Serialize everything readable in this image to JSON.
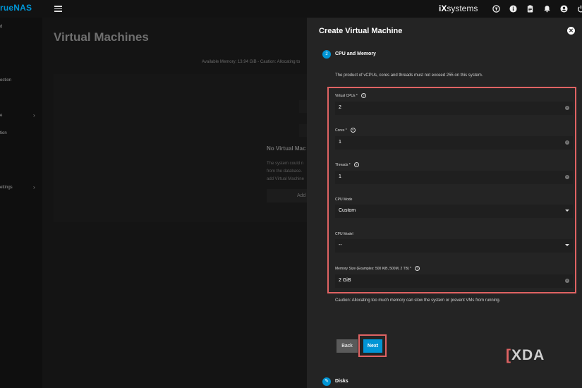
{
  "app": {
    "logo_text": "rueNAS",
    "brand_text": "systems",
    "brand_prefix": "iX"
  },
  "sidebar": {
    "items": [
      {
        "label": "d"
      },
      {
        "label": "ection"
      },
      {
        "label": "e"
      },
      {
        "label": "tion"
      },
      {
        "label": "ettings"
      }
    ]
  },
  "main": {
    "title": "Virtual Machines",
    "info": "Available Memory: 13.94 GiB - Caution: Allocating to",
    "empty_title": "No Virtual Mac",
    "empty_lines": [
      "The system could n",
      "from the database.",
      "add Virtual Machine"
    ],
    "add_button": "Add"
  },
  "panel": {
    "title": "Create Virtual Machine",
    "step_number": "2",
    "step_label": "CPU and Memory",
    "product_note": "The product of vCPUs, cores and threads must not exceed 255 on this system.",
    "fields": {
      "vcpus": {
        "label": "Virtual CPUs *",
        "value": "2"
      },
      "cores": {
        "label": "Cores *",
        "value": "1"
      },
      "threads": {
        "label": "Threads *",
        "value": "1"
      },
      "cpu_mode": {
        "label": "CPU Mode",
        "value": "Custom"
      },
      "cpu_model": {
        "label": "CPU Model",
        "value": "--"
      },
      "memory": {
        "label": "Memory Size (Examples: 500 KiB, 500M, 2 TB) *",
        "value": "2 GiB"
      }
    },
    "caution": "Caution: Allocating too much memory can slow the system or prevent VMs from running.",
    "back_label": "Back",
    "next_label": "Next",
    "next_step_label": "Disks"
  },
  "watermark": "XDA",
  "colors": {
    "accent": "#0095d5",
    "highlight": "#e06363",
    "panel_bg": "#242424"
  }
}
